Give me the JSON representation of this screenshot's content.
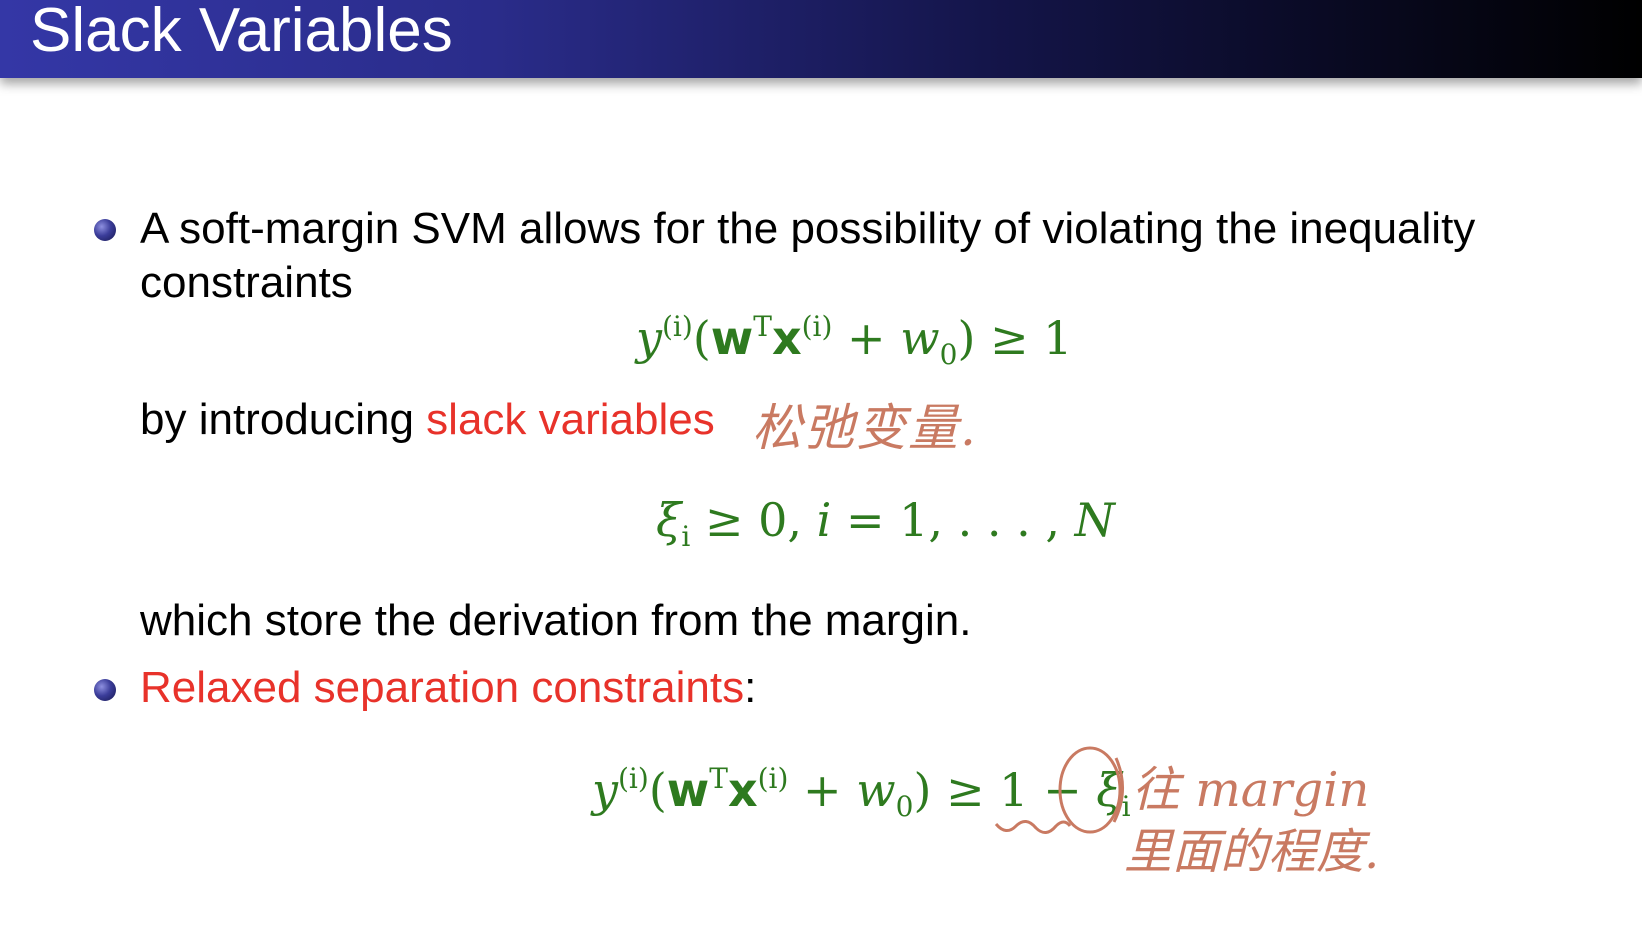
{
  "slide": {
    "title": "Slack Variables"
  },
  "bullet1": {
    "line1": "A soft-margin SVM allows for the possibility of violating the inequality",
    "line2": "constraints",
    "eq1": {
      "y": "y",
      "sup_i": "(i)",
      "open": "(",
      "w": "w",
      "sup_T": "T",
      "x": "x",
      "sup_xi": "(i)",
      "plus": " + ",
      "w0": "w",
      "sub_0": "0",
      "close": ")",
      "rel": " ≥ 1"
    },
    "intro_prefix": "by introducing ",
    "intro_red": "slack variables",
    "handwritten_cn": "松弛变量.",
    "eq2": {
      "xi": "ξ",
      "sub_i": "i",
      "rest1": " ≥ 0, ",
      "i": "i",
      "rest2": " = 1, . . . , ",
      "N": "N"
    },
    "line_after": "which store the derivation from the margin."
  },
  "bullet2": {
    "red_label": "Relaxed separation constraints",
    "colon": ":",
    "eq3": {
      "y": "y",
      "sup_i": "(i)",
      "open": "(",
      "w": "w",
      "sup_T": "T",
      "x": "x",
      "sup_xi": "(i)",
      "plus": " + ",
      "w0": "w",
      "sub_0": "0",
      "close": ")",
      "rel": " ≥ 1 − ",
      "xi": "ξ",
      "sub_i": "i"
    },
    "handwritten_line1": "往 margin",
    "handwritten_line2": "里面的程度."
  },
  "colors": {
    "math_green": "#2e7a1f",
    "emphasis_red": "#e8322a",
    "annotation": "#c97a62",
    "title_bar_start": "#3437a6",
    "title_bar_end": "#000000"
  }
}
